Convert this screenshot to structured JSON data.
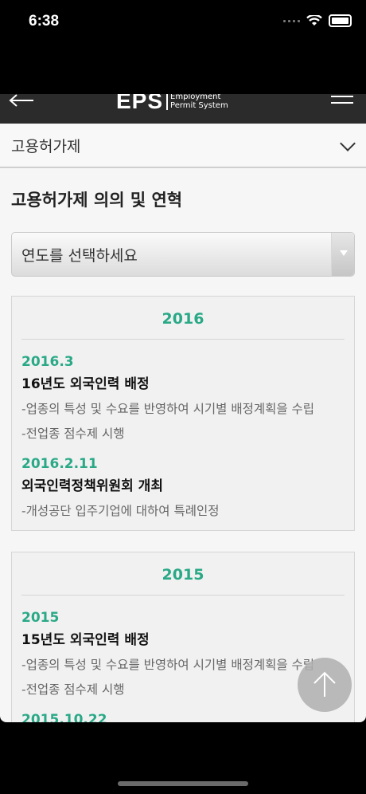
{
  "status_bar": {
    "time": "6:38"
  },
  "header": {
    "logo_mark": "EPS",
    "logo_line1": "Employment",
    "logo_line2": "Permit System"
  },
  "section_dropdown": {
    "label": "고용허가제"
  },
  "page": {
    "title": "고용허가제 의의 및 연혁",
    "year_select_value": "연도를 선택하세요"
  },
  "years": [
    {
      "year": "2016",
      "events": [
        {
          "date": "2016.3",
          "title": "16년도 외국인력 배정",
          "items": [
            "-업종의 특성 및 수요를 반영하여 시기별 배정계획을 수립",
            "-전업종 점수제 시행"
          ]
        },
        {
          "date": "2016.2.11",
          "title": "외국인력정책위원회 개최",
          "items": [
            "-개성공단 입주기업에 대하여 특례인정"
          ]
        }
      ]
    },
    {
      "year": "2015",
      "events": [
        {
          "date": "2015",
          "title": "15년도 외국인력 배정",
          "items": [
            "-업종의 특성 및 수요를 반영하여 시기별 배정계획을 수립",
            "-전업종 점수제 시행"
          ]
        },
        {
          "date": "2015.10.22",
          "title": "",
          "items": []
        }
      ]
    }
  ]
}
